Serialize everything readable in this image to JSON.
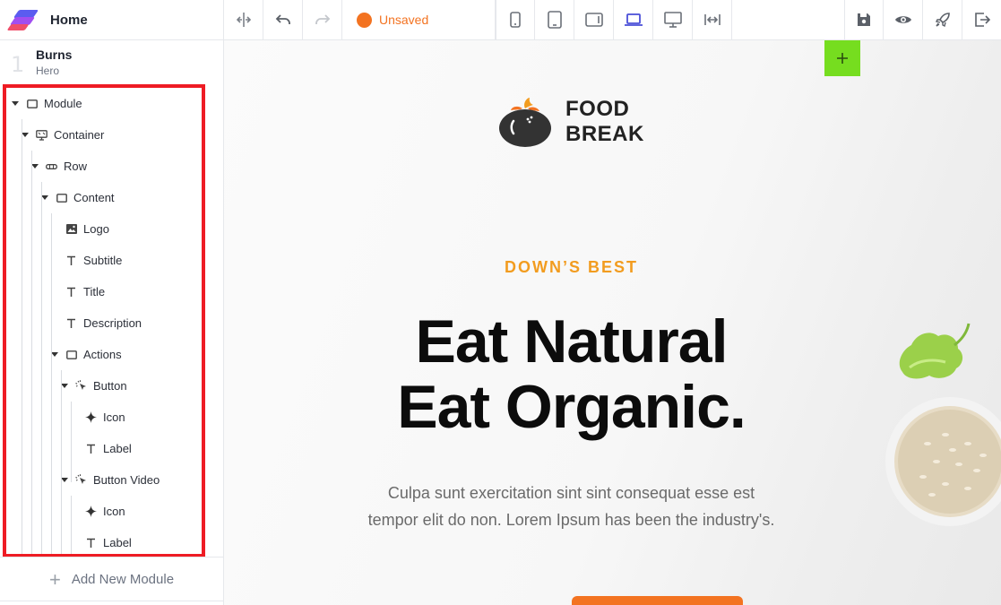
{
  "header": {
    "title": "Home"
  },
  "page": {
    "number": "1",
    "name": "Burns",
    "template": "Hero"
  },
  "tree": [
    {
      "label": "Module",
      "depth": 0,
      "icon": "square-icon",
      "expanded": true
    },
    {
      "label": "Container",
      "depth": 1,
      "icon": "monitor-icon",
      "expanded": true
    },
    {
      "label": "Row",
      "depth": 2,
      "icon": "row-icon",
      "expanded": true
    },
    {
      "label": "Content",
      "depth": 3,
      "icon": "square-icon",
      "expanded": true
    },
    {
      "label": "Logo",
      "depth": 4,
      "icon": "image-icon",
      "expanded": false
    },
    {
      "label": "Subtitle",
      "depth": 4,
      "icon": "text-icon",
      "expanded": false
    },
    {
      "label": "Title",
      "depth": 4,
      "icon": "text-icon",
      "expanded": false
    },
    {
      "label": "Description",
      "depth": 4,
      "icon": "text-icon",
      "expanded": false
    },
    {
      "label": "Actions",
      "depth": 4,
      "icon": "square-icon",
      "expanded": true
    },
    {
      "label": "Button",
      "depth": 5,
      "icon": "pointer-click-icon",
      "expanded": true
    },
    {
      "label": "Icon",
      "depth": 6,
      "icon": "sparkle-icon",
      "expanded": false
    },
    {
      "label": "Label",
      "depth": 6,
      "icon": "text-icon",
      "expanded": false
    },
    {
      "label": "Button Video",
      "depth": 5,
      "icon": "pointer-click-icon",
      "expanded": true
    },
    {
      "label": "Icon",
      "depth": 6,
      "icon": "sparkle-icon",
      "expanded": false
    },
    {
      "label": "Label",
      "depth": 6,
      "icon": "text-icon",
      "expanded": false
    }
  ],
  "sidebar": {
    "add_module_label": "Add New Module"
  },
  "toolbar": {
    "status_label": "Unsaved",
    "status_color": "#f37321",
    "active_device": "laptop-icon",
    "accent": "#4a4fd8"
  },
  "canvas": {
    "brand_line1": "FOOD",
    "brand_line2": "BREAK",
    "kicker": "DOWN’S BEST",
    "headline_line1": "Eat Natural",
    "headline_line2": "Eat Organic.",
    "description": "Culpa sunt exercitation sint sint consequat esse est tempor elit do non. Lorem Ipsum has been the industry's.",
    "kicker_color": "#f29c1f",
    "add_section_color": "#76dd1f"
  }
}
